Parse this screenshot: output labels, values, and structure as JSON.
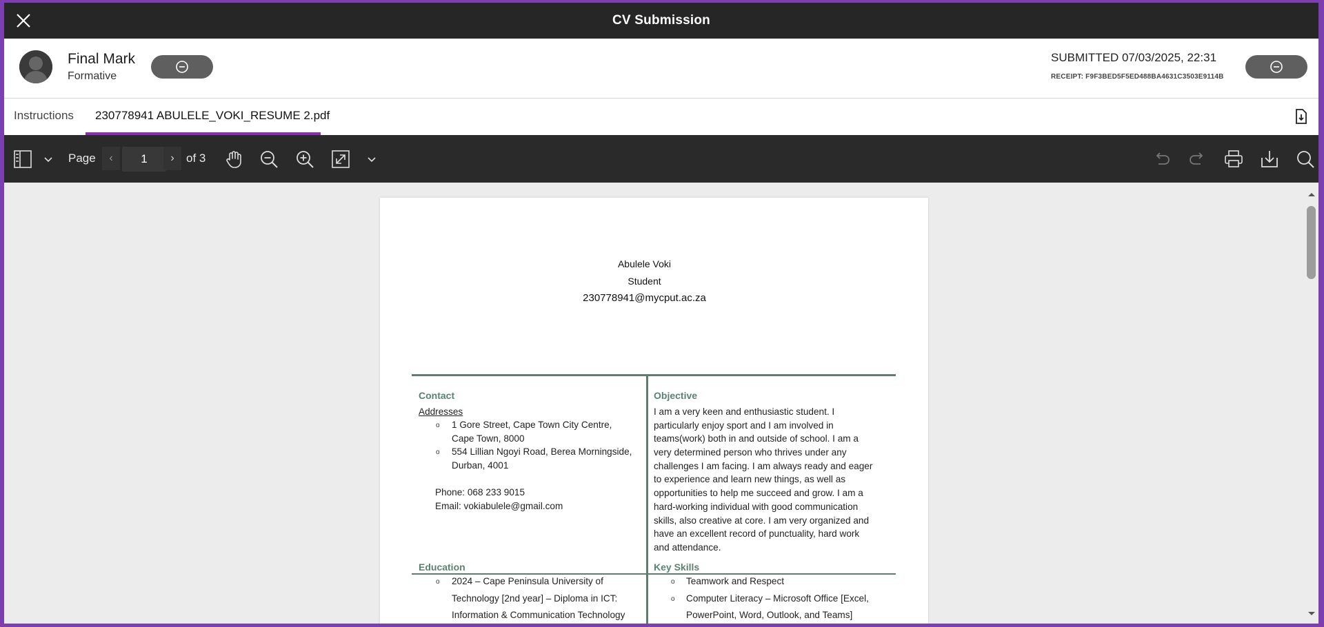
{
  "window": {
    "title": "CV Submission"
  },
  "grade": {
    "title": "Final Mark",
    "subtitle": "Formative",
    "submitted": "SUBMITTED 07/03/2025, 22:31",
    "receipt": "RECEIPT: F9F3BED5F5ED488BA4631C3503E9114B"
  },
  "tabs": [
    {
      "label": "Instructions",
      "active": false
    },
    {
      "label": "230778941 ABULELE_VOKI_RESUME 2.pdf",
      "active": true
    }
  ],
  "toolbar": {
    "page_label": "Page",
    "page_value": "1",
    "page_total": "of 3",
    "prev": "‹",
    "next": "›"
  },
  "document": {
    "name": "Abulele Voki",
    "role": "Student",
    "email": "230778941@mycput.ac.za",
    "contact": {
      "title": "Contact",
      "addresses_label": "Addresses",
      "address1_line1": "1 Gore Street, Cape Town City Centre,",
      "address1_line2": "Cape Town, 8000",
      "address2_line1": "554 Lillian Ngoyi Road, Berea Morningside,",
      "address2_line2": "Durban, 4001",
      "phone": "Phone: 068 233 9015",
      "email": "Email:  vokiabulele@gmail.com"
    },
    "objective": {
      "title": "Objective",
      "lines": [
        "I am a very keen and enthusiastic student. I",
        "particularly enjoy sport and I am involved in",
        "teams(work) both in and outside of school. I am a",
        "very determined person who thrives under any",
        "challenges I am facing. I am always ready and eager",
        "to experience and learn new things, as well as",
        "opportunities to help me succeed and grow. I am a",
        "hard-working individual with good communication",
        "skills, also creative at core. I am very organized and",
        "have an excellent record of punctuality, hard work",
        "and attendance."
      ]
    },
    "education": {
      "title": "Education",
      "line1": "2024 – Cape Peninsula University of",
      "line2": "Technology [2nd year] – Diploma in ICT:",
      "line3": "Information & Communication Technology"
    },
    "skills": {
      "title": "Key Skills",
      "item1": "Teamwork and Respect",
      "item2_line1": "Computer Literacy – Microsoft Office [Excel,",
      "item2_line2": "PowerPoint, Word, Outlook, and Teams]"
    }
  },
  "colors": {
    "titlebar": "#262626",
    "accent": "#8a2fae",
    "frame": "#7b3fb0",
    "section_title": "#5a8271"
  },
  "icons": [
    "close-icon",
    "avatar-icon",
    "minus-circle-icon",
    "download-doc-icon",
    "sidebar-toggle-icon",
    "chevron-down-icon",
    "hand-pan-icon",
    "zoom-out-icon",
    "zoom-in-icon",
    "fit-page-icon",
    "undo-icon",
    "redo-icon",
    "print-icon",
    "download-icon",
    "search-icon"
  ]
}
